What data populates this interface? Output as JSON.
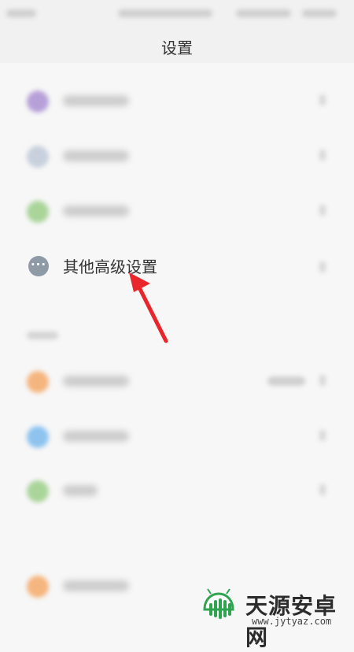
{
  "header": {
    "title": "设置"
  },
  "focused_item": {
    "label": "其他高级设置",
    "icon": "more-icon"
  },
  "watermark": {
    "brand": "天源安卓网",
    "url": "www.jytyaz.com"
  },
  "colors": {
    "arrow": "#e8262b",
    "more_icon_bg": "#8f9aa7",
    "watermark_green": "#2ea44f"
  }
}
